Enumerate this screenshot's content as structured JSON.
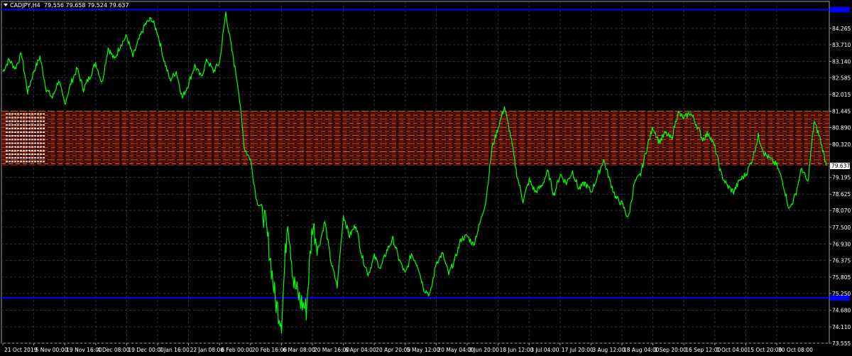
{
  "header": {
    "symbol_timeframe": "CADJPY,H4",
    "ohlc": "79.556 79.658 79.524 79.637"
  },
  "price_tag": "79.637",
  "colors": {
    "background": "#000000",
    "grid": "#2a3442",
    "price_line": "#00ff00",
    "support_resistance": "#0000ff",
    "zone_red": "#b81c1c",
    "zone_orange": "#ff9800",
    "axis_text": "#ffffff"
  },
  "chart_data": {
    "type": "line",
    "title": "CADJPY,H4",
    "xlabel": "",
    "ylabel": "",
    "ylim": [
      73.555,
      85.18
    ],
    "grid": true,
    "y_ticks": [
      "84.265",
      "83.710",
      "83.140",
      "82.585",
      "82.015",
      "81.445",
      "80.890",
      "80.320",
      "79.195",
      "78.625",
      "78.070",
      "77.500",
      "76.930",
      "76.375",
      "75.805",
      "75.250",
      "74.680",
      "74.110",
      "73.555"
    ],
    "x_ticks": [
      "21 Oct 2019",
      "5 Nov 00:00",
      "19 Nov 16:00",
      "4 Dec 08:00",
      "19 Dec 00:00",
      "7 Jan 16:00",
      "22 Jan 08:00",
      "6 Feb 00:00",
      "20 Feb 16:00",
      "6 Mar 08:00",
      "20 Mar 16:00",
      "6 Apr 04:00",
      "20 Apr 20:00",
      "5 May 12:00",
      "20 May 04:00",
      "3 Jun 20:00",
      "18 Jun 12:00",
      "3 Jul 04:00",
      "17 Jul 20:00",
      "3 Aug 12:00",
      "18 Aug 04:00",
      "1 Sep 20:00",
      "16 Sep 12:00",
      "1 Oct 04:00",
      "15 Oct 20:00",
      "30 Oct 08:00"
    ],
    "horizontal_lines": [
      {
        "name": "resistance",
        "y": 84.9,
        "color": "#0000ff"
      },
      {
        "name": "support",
        "y": 75.1,
        "color": "#0000ff"
      }
    ],
    "zone": {
      "y_top": 81.45,
      "y_bottom": 79.61
    },
    "series": [
      {
        "points": [
          [
            0,
            82.8
          ],
          [
            1,
            83.2
          ],
          [
            2,
            82.9
          ],
          [
            3,
            83.4
          ],
          [
            4,
            82.1
          ],
          [
            5,
            82.8
          ],
          [
            6,
            83.3
          ],
          [
            7,
            82.2
          ],
          [
            8,
            81.9
          ],
          [
            9,
            82.5
          ],
          [
            10,
            81.7
          ],
          [
            11,
            82.4
          ],
          [
            12,
            82.9
          ],
          [
            13,
            82.2
          ],
          [
            14,
            82.6
          ],
          [
            15,
            83.1
          ],
          [
            16,
            82.4
          ],
          [
            17,
            83.6
          ],
          [
            18,
            83.2
          ],
          [
            19,
            83.7
          ],
          [
            20,
            84.0
          ],
          [
            21,
            83.3
          ],
          [
            22,
            83.9
          ],
          [
            23,
            84.4
          ],
          [
            24,
            84.6
          ],
          [
            25,
            84.1
          ],
          [
            26,
            83.2
          ],
          [
            27,
            82.5
          ],
          [
            28,
            82.8
          ],
          [
            29,
            81.9
          ],
          [
            30,
            82.4
          ],
          [
            31,
            83.0
          ],
          [
            32,
            82.6
          ],
          [
            33,
            83.2
          ],
          [
            34,
            82.8
          ],
          [
            35,
            83.1
          ],
          [
            36,
            84.8
          ],
          [
            37,
            83.5
          ],
          [
            38,
            82.3
          ],
          [
            39,
            80.2
          ],
          [
            40,
            79.8
          ],
          [
            41,
            78.4
          ],
          [
            42,
            78.1
          ],
          [
            43,
            76.8
          ],
          [
            44,
            75.0
          ],
          [
            45,
            74.3
          ],
          [
            46,
            77.9
          ],
          [
            47,
            75.6
          ],
          [
            48,
            75.0
          ],
          [
            49,
            74.7
          ],
          [
            50,
            77.6
          ],
          [
            51,
            76.8
          ],
          [
            52,
            77.7
          ],
          [
            53,
            76.3
          ],
          [
            54,
            75.5
          ],
          [
            55,
            77.9
          ],
          [
            56,
            77.2
          ],
          [
            57,
            77.6
          ],
          [
            58,
            76.5
          ],
          [
            59,
            75.9
          ],
          [
            60,
            76.5
          ],
          [
            61,
            76.1
          ],
          [
            62,
            76.7
          ],
          [
            63,
            77.1
          ],
          [
            64,
            76.4
          ],
          [
            65,
            75.9
          ],
          [
            66,
            76.6
          ],
          [
            67,
            76.2
          ],
          [
            68,
            75.4
          ],
          [
            69,
            75.2
          ],
          [
            70,
            76.3
          ],
          [
            71,
            76.6
          ],
          [
            72,
            75.9
          ],
          [
            73,
            76.4
          ],
          [
            74,
            77.1
          ],
          [
            75,
            77.2
          ],
          [
            76,
            76.9
          ],
          [
            77,
            77.6
          ],
          [
            78,
            78.4
          ],
          [
            79,
            80.2
          ],
          [
            80,
            80.9
          ],
          [
            81,
            81.6
          ],
          [
            82,
            80.6
          ],
          [
            83,
            79.3
          ],
          [
            84,
            78.4
          ],
          [
            85,
            79.1
          ],
          [
            86,
            78.7
          ],
          [
            87,
            78.9
          ],
          [
            88,
            79.4
          ],
          [
            89,
            78.6
          ],
          [
            90,
            79.3
          ],
          [
            91,
            79.0
          ],
          [
            92,
            79.4
          ],
          [
            93,
            78.8
          ],
          [
            94,
            79.0
          ],
          [
            95,
            78.7
          ],
          [
            96,
            79.2
          ],
          [
            97,
            79.8
          ],
          [
            98,
            79.1
          ],
          [
            99,
            78.5
          ],
          [
            100,
            78.3
          ],
          [
            101,
            77.8
          ],
          [
            102,
            79.0
          ],
          [
            103,
            79.3
          ],
          [
            104,
            80.2
          ],
          [
            105,
            80.9
          ],
          [
            106,
            80.4
          ],
          [
            107,
            80.7
          ],
          [
            108,
            80.5
          ],
          [
            109,
            81.4
          ],
          [
            110,
            81.2
          ],
          [
            111,
            81.4
          ],
          [
            112,
            81.0
          ],
          [
            113,
            80.5
          ],
          [
            114,
            80.7
          ],
          [
            115,
            80.2
          ],
          [
            116,
            79.3
          ],
          [
            117,
            78.9
          ],
          [
            118,
            78.7
          ],
          [
            119,
            79.1
          ],
          [
            120,
            79.3
          ],
          [
            121,
            79.8
          ],
          [
            122,
            80.6
          ],
          [
            123,
            80.0
          ],
          [
            124,
            79.8
          ],
          [
            125,
            79.6
          ],
          [
            126,
            79.0
          ],
          [
            127,
            78.1
          ],
          [
            128,
            78.6
          ],
          [
            129,
            79.5
          ],
          [
            130,
            79.0
          ],
          [
            131,
            81.1
          ],
          [
            132,
            80.5
          ],
          [
            133,
            79.6
          ]
        ]
      }
    ]
  }
}
